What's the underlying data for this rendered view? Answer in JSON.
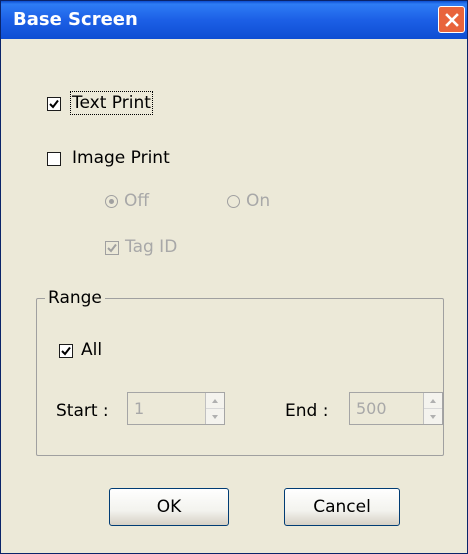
{
  "window": {
    "title": "Base Screen"
  },
  "options": {
    "text_print": {
      "label": "Text Print",
      "checked": true
    },
    "image_print": {
      "label": "Image Print",
      "checked": false
    },
    "mode_off": {
      "label": "Off",
      "selected": true
    },
    "mode_on": {
      "label": "On",
      "selected": false
    },
    "tag_id": {
      "label": "Tag ID",
      "checked": true
    }
  },
  "range": {
    "title": "Range",
    "all": {
      "label": "All",
      "checked": true
    },
    "start": {
      "label": "Start :",
      "value": "1"
    },
    "end": {
      "label": "End :",
      "value": "500"
    }
  },
  "buttons": {
    "ok": "OK",
    "cancel": "Cancel"
  }
}
